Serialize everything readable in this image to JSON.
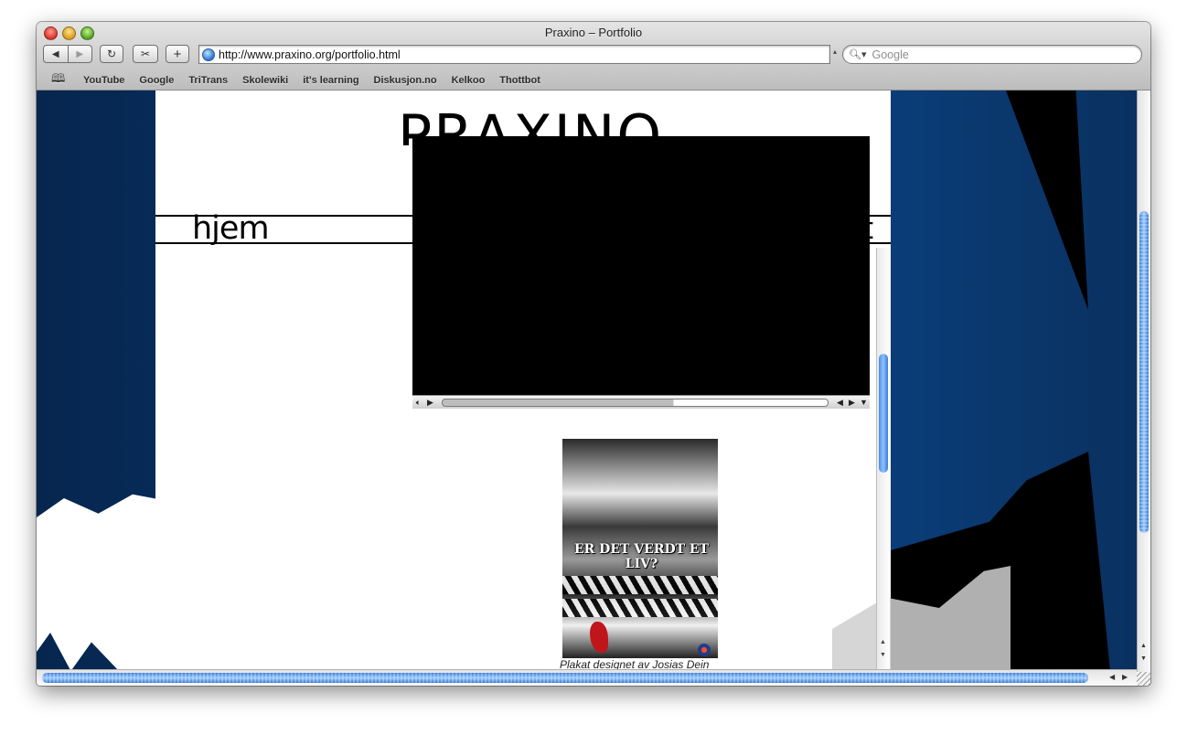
{
  "window": {
    "title": "Praxino – Portfolio"
  },
  "toolbar": {
    "back_icon": "◀",
    "forward_icon": "▶",
    "reload_icon": "↻",
    "add_icon": "+",
    "url": "http://www.praxino.org/portfolio.html",
    "search_placeholder": "Google"
  },
  "bookmarks": {
    "items": [
      "YouTube",
      "Google",
      "TriTrans",
      "Skolewiki",
      "it's learning",
      "Diskusjon.no",
      "Kelkoo",
      "Thottbot"
    ]
  },
  "page": {
    "logo": "PRAXINO",
    "nav": {
      "home": "hjem",
      "contact": "kontakt"
    },
    "poster_title": "ER DET VERDT ET LIV?",
    "caption": "Plakat designet av Josias Dein"
  },
  "video": {
    "progress": 0.6
  },
  "colors": {
    "background_blue": "#0a3e7a",
    "scroll_thumb": "#5ea3f0"
  }
}
